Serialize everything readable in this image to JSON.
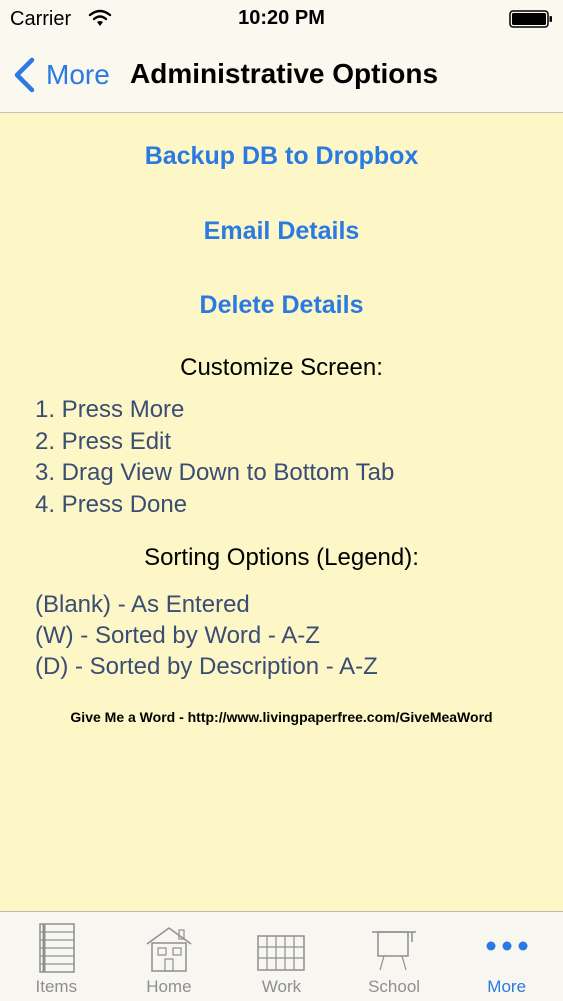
{
  "status_bar": {
    "carrier": "Carrier",
    "time": "10:20 PM"
  },
  "nav": {
    "back_label": "More",
    "title": "Administrative Options"
  },
  "actions": {
    "backup": "Backup DB to Dropbox",
    "email": "Email Details",
    "delete": "Delete Details"
  },
  "customize": {
    "heading": "Customize Screen:",
    "steps": [
      "1. Press More",
      "2. Press Edit",
      "3. Drag View Down to Bottom Tab",
      "4. Press Done"
    ]
  },
  "sorting": {
    "heading": "Sorting Options (Legend):",
    "items": [
      "(Blank) - As Entered",
      "(W) - Sorted by Word - A-Z",
      "(D) - Sorted by Description - A-Z"
    ]
  },
  "footer": {
    "text": "Give Me a Word - http://www.livingpaperfree.com/GiveMeaWord"
  },
  "tabs": [
    {
      "label": "Items",
      "icon": "list-icon",
      "active": false
    },
    {
      "label": "Home",
      "icon": "house-icon",
      "active": false
    },
    {
      "label": "Work",
      "icon": "grid-icon",
      "active": false
    },
    {
      "label": "School",
      "icon": "whiteboard-icon",
      "active": false
    },
    {
      "label": "More",
      "icon": "more-dots-icon",
      "active": true
    }
  ],
  "colors": {
    "accent": "#2a7ae2",
    "background": "#fdf6c7",
    "list_text": "#3a4d73",
    "inactive_tab": "#8f8f8f"
  }
}
